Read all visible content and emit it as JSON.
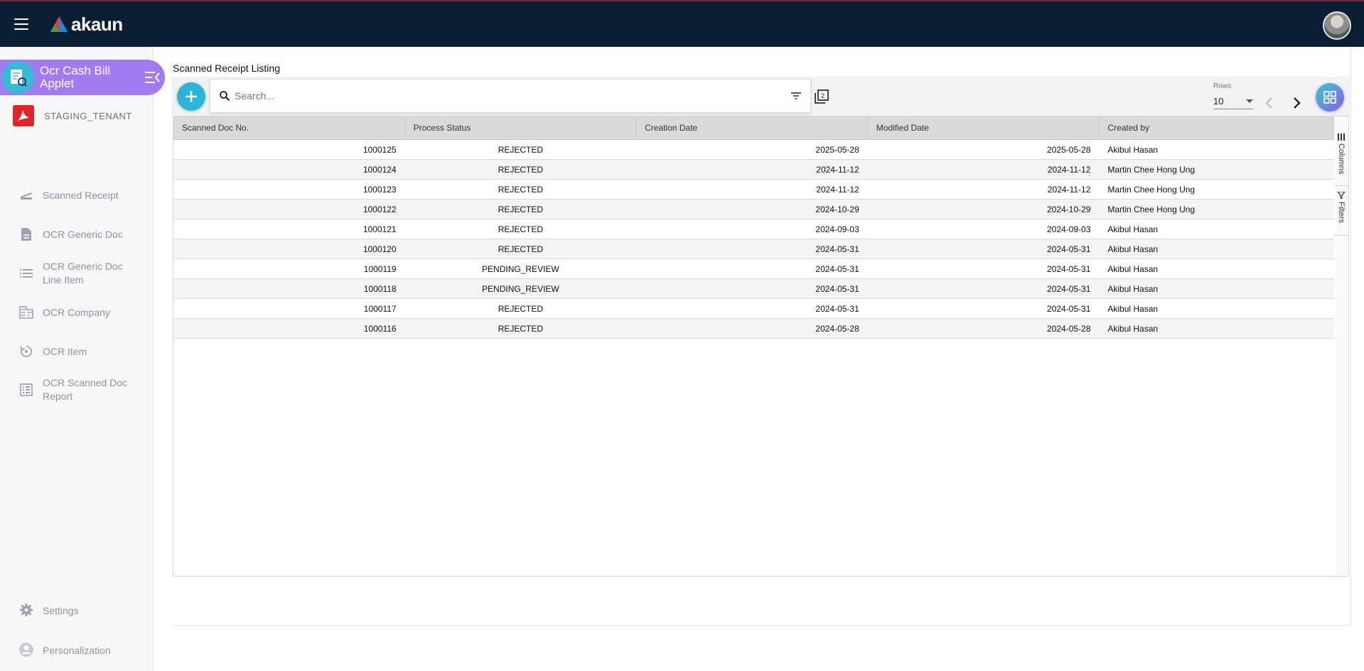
{
  "header": {
    "logo_text": "akaun",
    "menu_icon": "hamburger-icon",
    "avatar_icon": "user-avatar"
  },
  "sidebar": {
    "applet_title": "Ocr Cash Bill Applet",
    "tenant": "STAGING_TENANT",
    "items": [
      {
        "label": "Scanned Receipt",
        "icon": "scanner-icon"
      },
      {
        "label": "OCR Generic Doc",
        "icon": "document-icon"
      },
      {
        "label": "OCR Generic Doc Line Item",
        "icon": "list-icon"
      },
      {
        "label": "OCR Company",
        "icon": "building-icon"
      },
      {
        "label": "OCR Item",
        "icon": "item-icon"
      },
      {
        "label": "OCR Scanned Doc Report",
        "icon": "report-icon"
      }
    ],
    "bottom": [
      {
        "label": "Settings",
        "icon": "gear-icon"
      },
      {
        "label": "Personalization",
        "icon": "person-icon"
      }
    ]
  },
  "main": {
    "title": "Scanned Receipt Listing",
    "search_placeholder": "Search...",
    "rows_label": "Rows",
    "rows_value": "10",
    "side_tabs": {
      "columns": "Columns",
      "filters": "Filters"
    }
  },
  "table": {
    "columns": [
      "Scanned Doc No.",
      "Process Status",
      "Creation Date",
      "Modified Date",
      "Created by"
    ],
    "rows": [
      [
        "1000125",
        "REJECTED",
        "2025-05-28",
        "2025-05-28",
        "Akibul Hasan"
      ],
      [
        "1000124",
        "REJECTED",
        "2024-11-12",
        "2024-11-12",
        "Martin Chee Hong Ung"
      ],
      [
        "1000123",
        "REJECTED",
        "2024-11-12",
        "2024-11-12",
        "Martin Chee Hong Ung"
      ],
      [
        "1000122",
        "REJECTED",
        "2024-10-29",
        "2024-10-29",
        "Martin Chee Hong Ung"
      ],
      [
        "1000121",
        "REJECTED",
        "2024-09-03",
        "2024-09-03",
        "Akibul Hasan"
      ],
      [
        "1000120",
        "REJECTED",
        "2024-05-31",
        "2024-05-31",
        "Akibul Hasan"
      ],
      [
        "1000119",
        "PENDING_REVIEW",
        "2024-05-31",
        "2024-05-31",
        "Akibul Hasan"
      ],
      [
        "1000118",
        "PENDING_REVIEW",
        "2024-05-31",
        "2024-05-31",
        "Akibul Hasan"
      ],
      [
        "1000117",
        "REJECTED",
        "2024-05-31",
        "2024-05-31",
        "Akibul Hasan"
      ],
      [
        "1000116",
        "REJECTED",
        "2024-05-28",
        "2024-05-28",
        "Akibul Hasan"
      ]
    ]
  },
  "colors": {
    "topbar": "#0b1d33",
    "applet_pill": "#a07bf2",
    "accent": "#2ab5d9",
    "tenant_badge": "#e0262b"
  }
}
